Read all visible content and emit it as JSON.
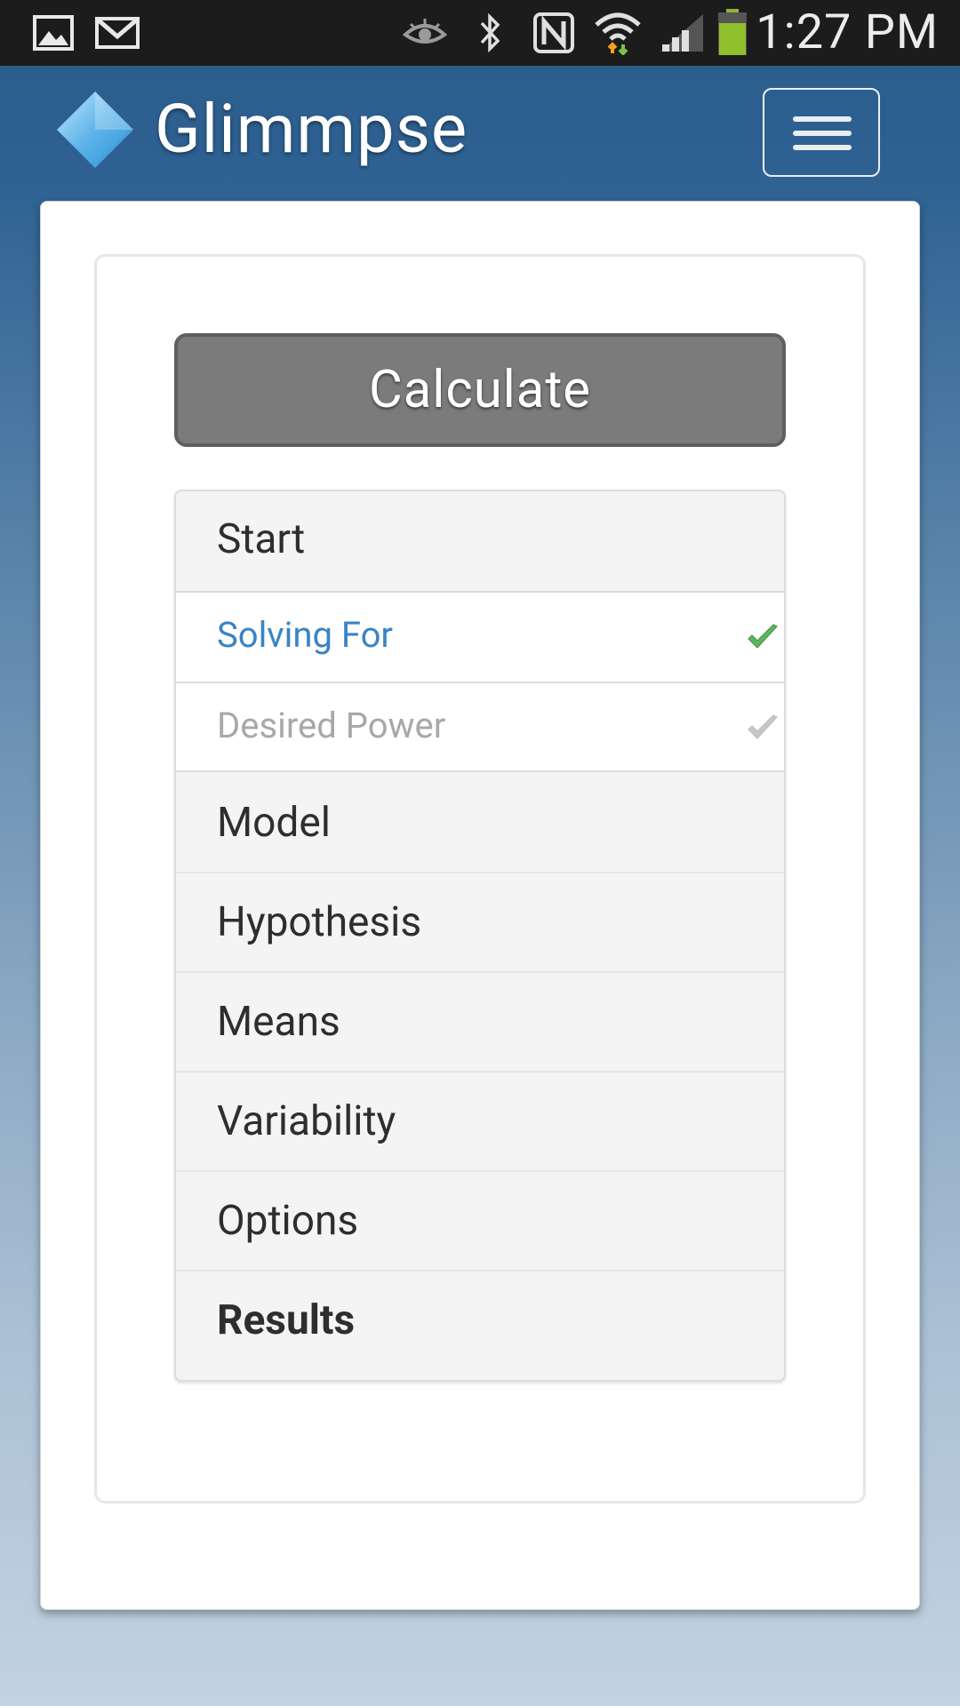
{
  "status_bar": {
    "time": "1:27 PM",
    "icons": [
      "gallery-icon",
      "gmail-icon",
      "eye-icon",
      "bluetooth-icon",
      "nfc-icon",
      "wifi-icon",
      "signal-icon",
      "battery-icon"
    ]
  },
  "header": {
    "app_title": "Glimmpse",
    "menu_icon": "hamburger-menu-icon"
  },
  "actions": {
    "calculate_label": "Calculate"
  },
  "steps": {
    "items": [
      {
        "label": "Start",
        "type": "section"
      },
      {
        "label": "Solving For",
        "type": "sub",
        "state": "active",
        "completed": true,
        "check_color": "#5cb85c"
      },
      {
        "label": "Desired Power",
        "type": "sub",
        "state": "disabled",
        "completed": true,
        "check_color": "#c8c8c8"
      },
      {
        "label": "Model",
        "type": "section"
      },
      {
        "label": "Hypothesis",
        "type": "section"
      },
      {
        "label": "Means",
        "type": "section"
      },
      {
        "label": "Variability",
        "type": "section"
      },
      {
        "label": "Options",
        "type": "section"
      },
      {
        "label": "Results",
        "type": "section",
        "bold": true
      }
    ]
  },
  "colors": {
    "header_bg": "#2e6192",
    "link_active": "#3a84c4",
    "calculate_bg": "#7b7b7b",
    "check_green": "#5cb85c"
  }
}
